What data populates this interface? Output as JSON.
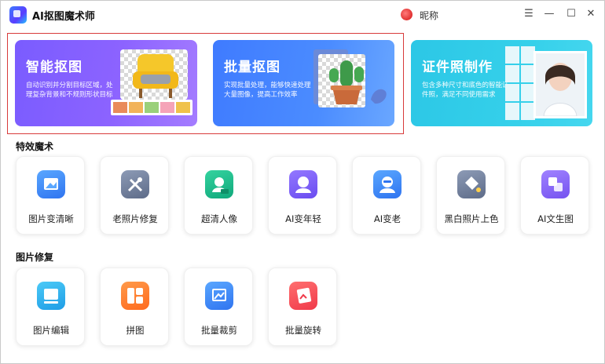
{
  "app": {
    "title": "AI抠图魔术师",
    "nickname": "昵称"
  },
  "window_controls": {
    "menu": "☰",
    "minimize": "—",
    "maximize": "☐",
    "close": "✕"
  },
  "banner": [
    {
      "title": "智能抠图",
      "desc": "自动识别并分割目标区域，处理复杂背景和不规则形状目标",
      "color": "#8260ff"
    },
    {
      "title": "批量抠图",
      "desc": "实现批量处理，能够快速处理大量图像，提高工作效率",
      "color": "#4685ff"
    },
    {
      "title": "证件照制作",
      "desc": "包含多种尺寸和底色的智能证件照，满足不同使用需求",
      "color": "#32cde8"
    }
  ],
  "sections": [
    {
      "title": "特效魔术",
      "tools": [
        {
          "label": "图片变清晰",
          "icon": "image-enhance-icon",
          "color": "#3d8bff"
        },
        {
          "label": "老照片修复",
          "icon": "tools-repair-icon",
          "color": "#6e7d9a"
        },
        {
          "label": "超清人像",
          "icon": "hd-portrait-icon",
          "color": "#1fbf8f"
        },
        {
          "label": "AI变年轻",
          "icon": "young-face-icon",
          "color": "#7b5cf5"
        },
        {
          "label": "AI变老",
          "icon": "old-face-icon",
          "color": "#3d8bff"
        },
        {
          "label": "黑白照片上色",
          "icon": "colorize-bucket-icon",
          "color": "#6e7d9a"
        },
        {
          "label": "AI文生图",
          "icon": "text-to-image-icon",
          "color": "#8a63f5"
        }
      ]
    },
    {
      "title": "图片修复",
      "tools": [
        {
          "label": "图片编辑",
          "icon": "image-edit-icon",
          "color": "#2fb4ee"
        },
        {
          "label": "拼图",
          "icon": "collage-icon",
          "color": "#ff7a2d"
        },
        {
          "label": "批量裁剪",
          "icon": "crop-icon",
          "color": "#3d8bff"
        },
        {
          "label": "批量旋转",
          "icon": "rotate-image-icon",
          "color": "#ff4b55"
        }
      ]
    }
  ]
}
